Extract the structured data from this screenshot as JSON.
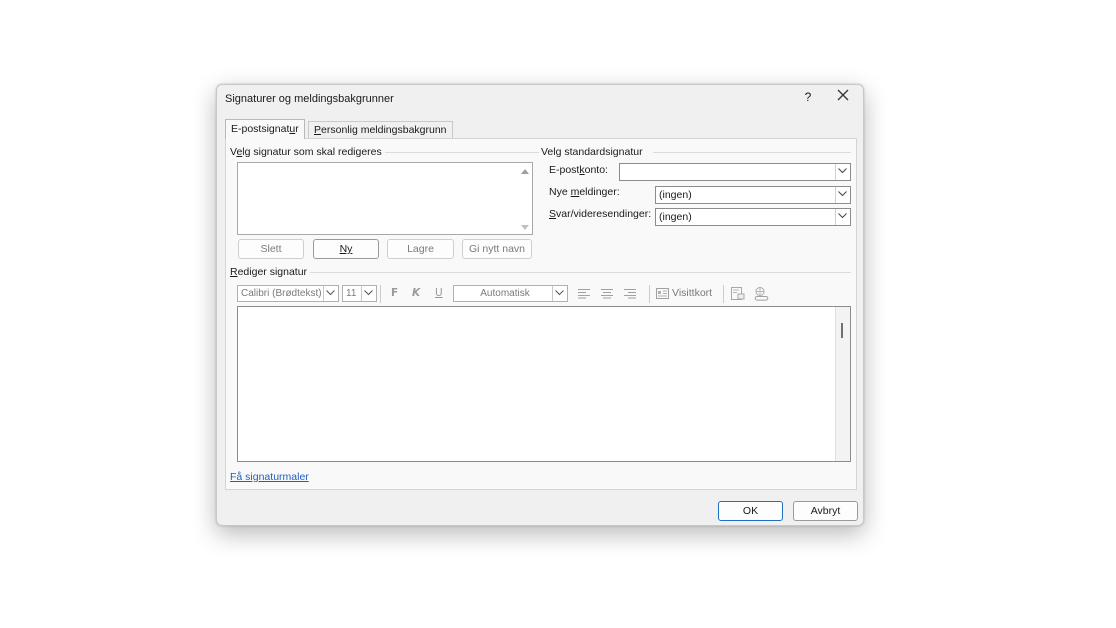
{
  "dialog": {
    "title": "Signaturer og meldingsbakgrunner",
    "help_label": "?"
  },
  "tabs": {
    "email_signature": {
      "pre": "E-postsignat",
      "acc": "u",
      "post": "r"
    },
    "personal_stationery": {
      "pre": "",
      "acc": "P",
      "post": "ersonlig meldingsbakgrunn"
    }
  },
  "select_signature": {
    "label": {
      "pre": "V",
      "acc": "e",
      "post": "lg signatur som skal redigeres"
    },
    "items": []
  },
  "signature_buttons": {
    "delete": "Slett",
    "new": "Ny",
    "save": "Lagre",
    "rename": "Gi nytt navn"
  },
  "default_signature": {
    "label": "Velg standardsignatur",
    "email_account": {
      "label_pre": "E-post",
      "label_acc": "k",
      "label_post": "onto:",
      "value": ""
    },
    "new_messages": {
      "label_pre": "Nye ",
      "label_acc": "m",
      "label_post": "eldinger:",
      "value": "(ingen)"
    },
    "replies_forwards": {
      "label_pre": "",
      "label_acc": "S",
      "label_post": "var/videresendinger:",
      "value": "(ingen)"
    }
  },
  "edit_signature": {
    "label": {
      "pre": "",
      "acc": "R",
      "post": "ediger signatur"
    },
    "font": "Calibri (Brødtekst)",
    "size": "11",
    "bold": "F",
    "italic": "K",
    "underline": "U",
    "color": "Automatisk",
    "business_card": "Visittkort",
    "content": ""
  },
  "templates_link": "Få signaturmaler",
  "footer": {
    "ok": "OK",
    "cancel": "Avbryt"
  },
  "colors": {
    "accent": "#1f6fc5",
    "link": "#1f5fbf",
    "dialog_bg": "#f0f0f0"
  }
}
